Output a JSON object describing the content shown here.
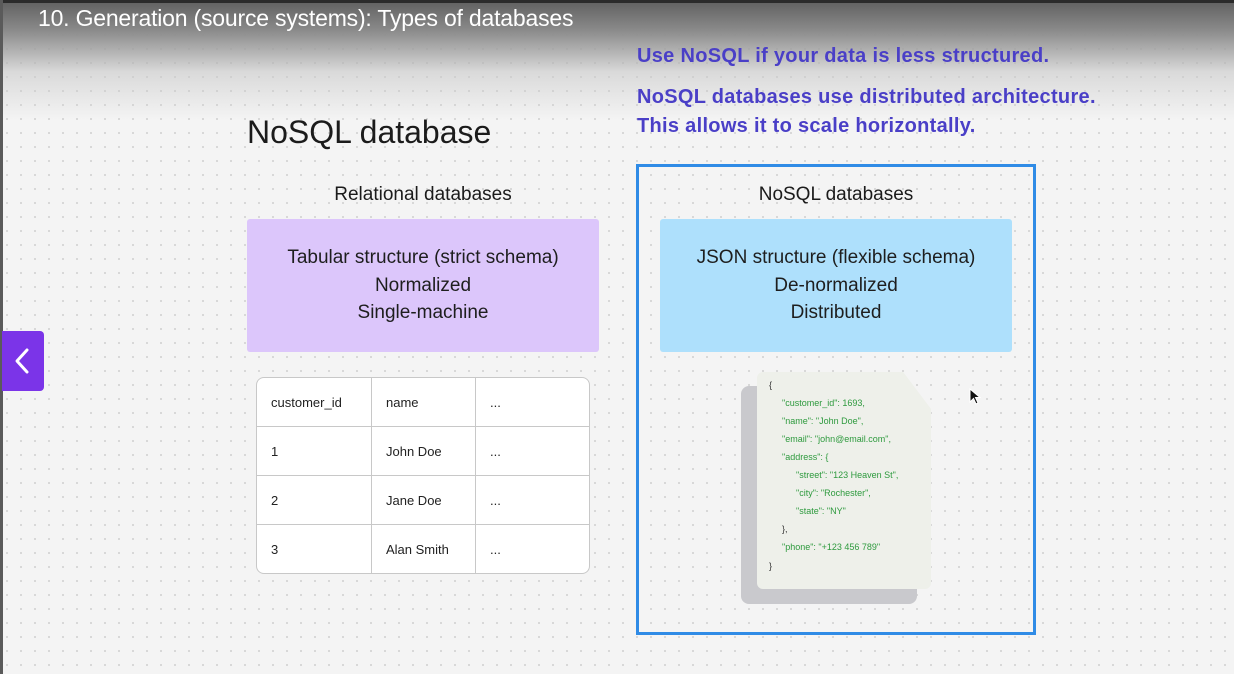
{
  "video": {
    "title": "10. Generation (source systems): Types of databases"
  },
  "notes": [
    "Use NoSQL if your data is less structured.",
    "NoSQL databases use distributed architecture.",
    "This allows it to scale horizontally."
  ],
  "slide": {
    "title": "NoSQL database",
    "relational": {
      "title": "Relational databases",
      "features": [
        "Tabular structure (strict schema)",
        "Normalized",
        "Single-machine"
      ],
      "table": {
        "headers": [
          "customer_id",
          "name",
          "..."
        ],
        "rows": [
          [
            "1",
            "John Doe",
            "..."
          ],
          [
            "2",
            "Jane Doe",
            "..."
          ],
          [
            "3",
            "Alan Smith",
            "..."
          ]
        ]
      }
    },
    "nosql": {
      "title": "NoSQL databases",
      "features": [
        "JSON structure (flexible schema)",
        "De-normalized",
        "Distributed"
      ],
      "json_lines": [
        "{",
        "\"customer_id\": 1693,",
        "\"name\": \"John Doe\",",
        "\"email\": \"john@email.com\",",
        "\"address\": {",
        "\"street\": \"123 Heaven St\",",
        "\"city\": \"Rochester\",",
        "\"state\": \"NY\"",
        "},",
        "\"phone\": \"+123 456 789\"",
        "}"
      ]
    }
  },
  "colors": {
    "accent_purple": "#7b34e8",
    "note_text": "#4a3fc7",
    "relational_box": "#dcc6fb",
    "nosql_box": "#aee0fc",
    "nosql_frame": "#2f8be6",
    "json_text": "#2e9a3e"
  },
  "icons": {
    "nav": "chevron-left-icon",
    "cursor": "mouse-pointer-icon"
  }
}
